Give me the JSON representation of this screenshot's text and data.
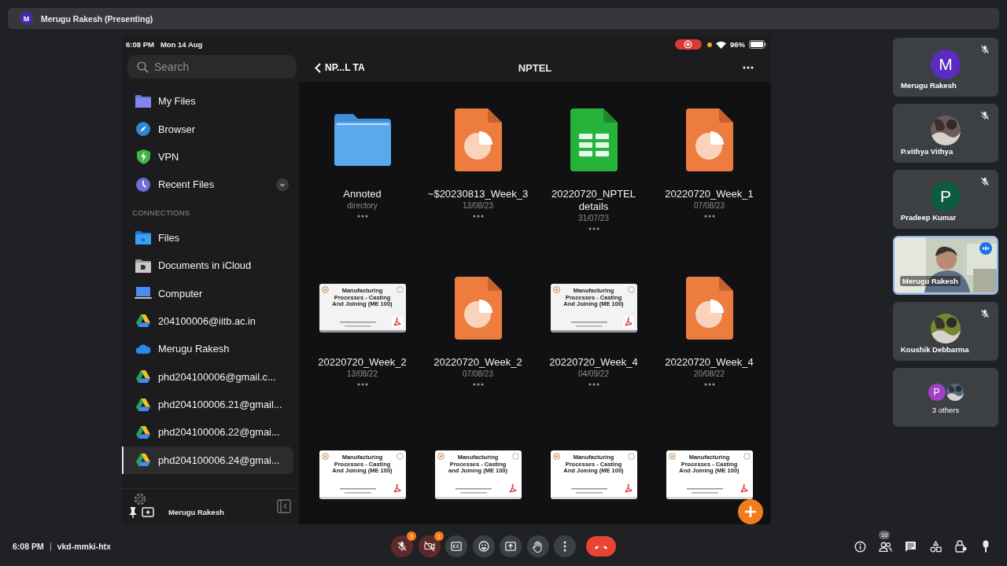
{
  "banner": {
    "avatar": "M",
    "title": "Merugu Rakesh (Presenting)",
    "color": "#4a2aa8"
  },
  "tablet": {
    "status": {
      "time": "6:08 PM",
      "date": "Mon 14 Aug",
      "recording": true,
      "battery": "96%"
    },
    "sidebar": {
      "search": {
        "placeholder": "Search"
      },
      "items": [
        {
          "label": "My Files",
          "kind": "myfiles",
          "selected": false,
          "expandable": false
        },
        {
          "label": "Browser",
          "kind": "browser",
          "selected": false,
          "expandable": false
        },
        {
          "label": "VPN",
          "kind": "vpn",
          "selected": false,
          "expandable": false
        },
        {
          "label": "Recent Files",
          "kind": "recent",
          "selected": false,
          "expandable": true
        }
      ],
      "section": "CONNECTIONS",
      "connections": [
        {
          "label": "Files",
          "kind": "files",
          "selected": false
        },
        {
          "label": "Documents in iCloud",
          "kind": "icloud",
          "selected": false
        },
        {
          "label": "Computer",
          "kind": "computer",
          "selected": false
        },
        {
          "label": "204100006@iitb.ac.in",
          "kind": "drive",
          "selected": false
        },
        {
          "label": "Merugu Rakesh",
          "kind": "onedrive",
          "selected": false
        },
        {
          "label": "phd204100006@gmail.c...",
          "kind": "drive",
          "selected": false
        },
        {
          "label": "phd204100006.21@gmail...",
          "kind": "drive",
          "selected": false
        },
        {
          "label": "phd204100006.22@gmai...",
          "kind": "drive",
          "selected": false
        },
        {
          "label": "phd204100006.24@gmai...",
          "kind": "drive",
          "selected": true
        }
      ],
      "footer": {
        "name": "Merugu Rakesh"
      }
    },
    "nav": {
      "back": "NP...L TA",
      "title": "NPTEL"
    },
    "files": [
      {
        "kind": "folder",
        "name": "Annoted",
        "meta": "directory"
      },
      {
        "kind": "slides",
        "name": "~$20230813_Week_3",
        "meta": "13/08/23"
      },
      {
        "kind": "sheet",
        "name": "20220720_NPTEL details",
        "meta": "31/07/23"
      },
      {
        "kind": "slides",
        "name": "20220720_Week_1",
        "meta": "07/08/23"
      },
      {
        "kind": "pdf",
        "doc_title": "Manufacturing Processes - Casting And Joining (ME 100)",
        "name": "20220720_Week_2",
        "meta": "13/08/22"
      },
      {
        "kind": "slides",
        "name": "20220720_Week_2",
        "meta": "07/08/23"
      },
      {
        "kind": "pdf",
        "doc_title": "Manufacturing Processes - Casting And Joining (ME 100)",
        "name": "20220720_Week_4",
        "meta": "04/09/22"
      },
      {
        "kind": "slides",
        "name": "20220720_Week_4",
        "meta": "20/08/22"
      },
      {
        "kind": "pdf",
        "doc_title": "Manufacturing Processes - Casting And Joining (ME 100)"
      },
      {
        "kind": "pdf",
        "doc_title": "Manufacturing Processes - Casting and Joining (ME 100)"
      },
      {
        "kind": "pdf",
        "doc_title": "Manufacturing Processes - Casting And Joining (ME 100)"
      },
      {
        "kind": "pdf",
        "doc_title": "Manufacturing Processes - Casting And Joining (ME 100)"
      }
    ]
  },
  "participants": [
    {
      "kind": "letter",
      "letter": "M",
      "color": "#5b2bc2",
      "name": "Merugu Rakesh",
      "muted": true
    },
    {
      "color": "#6b5a55",
      "name": "P.vithya Vithya",
      "muted": true
    },
    {
      "kind": "letter",
      "letter": "P",
      "color": "#0d5c3f",
      "name": "Pradeep Kumar",
      "muted": true
    },
    {
      "kind": "video",
      "name": "Merugu Rakesh",
      "muted": false
    },
    {
      "color": "#74892f",
      "name": "Koushik Debbarma",
      "muted": true
    },
    {
      "kind": "others",
      "letter": "P",
      "color": "#a23fc4",
      "name": "3 others",
      "muted": false
    }
  ],
  "bottom_bar": {
    "time": "6:08 PM",
    "meeting_code": "vkd-mmki-htx",
    "controls": [
      {
        "kind": "mic",
        "off": true,
        "alert": "!"
      },
      {
        "kind": "camera",
        "off": true,
        "alert": "!"
      },
      {
        "kind": "captions",
        "off": false
      },
      {
        "kind": "emoji",
        "off": false
      },
      {
        "kind": "present",
        "off": false
      },
      {
        "kind": "hand",
        "off": false
      },
      {
        "kind": "more",
        "off": false
      },
      {
        "kind": "end"
      }
    ],
    "tools": [
      {
        "kind": "info"
      },
      {
        "kind": "people",
        "badge": "10"
      },
      {
        "kind": "chat"
      },
      {
        "kind": "activities"
      },
      {
        "kind": "lock"
      },
      {
        "kind": "pin"
      }
    ]
  }
}
